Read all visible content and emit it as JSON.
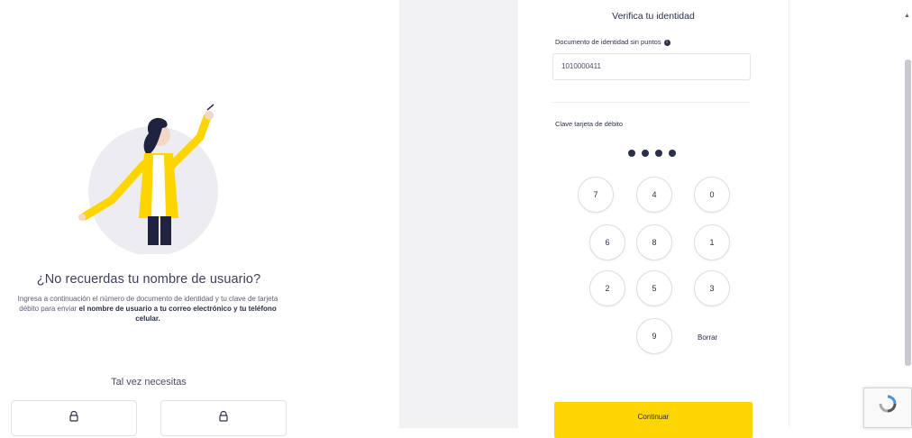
{
  "left": {
    "title": "¿No recuerdas tu nombre de usuario?",
    "description_prefix": "Ingresa a continuación el número de documento de identidad y tu clave de tarjeta débito para enviar ",
    "description_bold": "el nombre de usuario a tu correo electrónico y tu teléfono celular.",
    "maybe_label": "Tal vez necesitas"
  },
  "form": {
    "title": "Verifica tu identidad",
    "doc_label": "Documento de identidad sin puntos",
    "doc_value": "1010000411",
    "password_label": "Clave tarjeta de débito",
    "pin_filled": 4,
    "keys": [
      "7",
      "4",
      "0",
      "6",
      "8",
      "1",
      "2",
      "5",
      "3",
      "9"
    ],
    "delete_label": "Borrar",
    "continue_label": "Continuar"
  },
  "colors": {
    "accent_yellow": "#fdd500",
    "text_dark": "#2b2f4a",
    "panel_gray": "#f2f2f4"
  },
  "icons": {
    "option_icon": "lock-icon",
    "info_icon": "info-icon",
    "captcha_icon": "recaptcha-icon"
  }
}
